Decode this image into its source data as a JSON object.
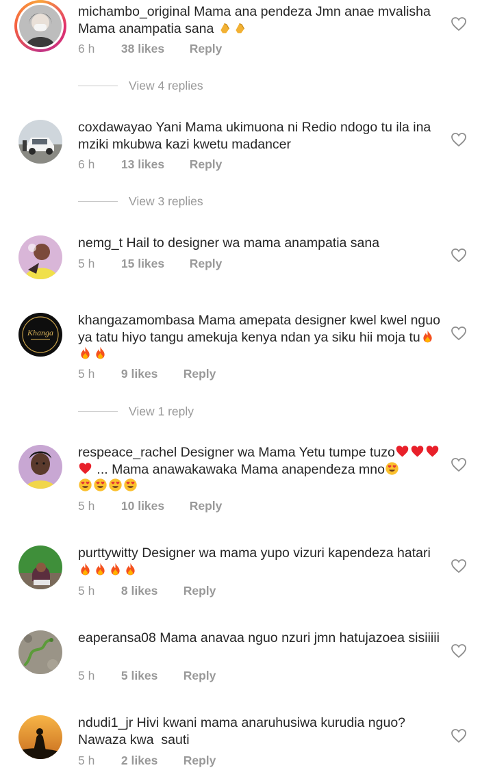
{
  "comments": [
    {
      "username": "michambo_original",
      "text": "Mama ana pendeza Jmn anae mvalisha Mama anampatia sana",
      "emojis": [
        "clap",
        "clap"
      ],
      "time": "6 h",
      "likes": "38 likes",
      "reply": "Reply",
      "view_replies": "View 4 replies",
      "avatar_icon": "woman-mask-avatar"
    },
    {
      "username": "coxdawayao",
      "text": "Yani Mama ukimuona ni Redio ndogo tu ila ina mziki mkubwa kazi kwetu madancer",
      "emojis": [],
      "time": "6 h",
      "likes": "13 likes",
      "reply": "Reply",
      "view_replies": "View 3 replies",
      "avatar_icon": "car-avatar"
    },
    {
      "username": "nemg_t",
      "text": "Hail to designer wa mama anampatia sana",
      "emojis": [],
      "time": "5 h",
      "likes": "15 likes",
      "reply": "Reply",
      "view_replies": "",
      "avatar_icon": "woman-yellow-avatar"
    },
    {
      "username": "khangazamombasa",
      "text": "Mama amepata designer kwel kwel nguo ya tatu hiyo tangu amekuja kenya ndan ya siku hii moja tu",
      "emojis": [
        "fire",
        "fire",
        "fire"
      ],
      "time": "5 h",
      "likes": "9 likes",
      "reply": "Reply",
      "view_replies": "View 1 reply",
      "avatar_icon": "khanga-logo-avatar",
      "avatar_text": "Khanga"
    },
    {
      "username": "respeace_rachel",
      "text_parts": [
        {
          "t": "Designer wa Mama Yetu tumpe tuzo"
        },
        {
          "e": "heart"
        },
        {
          "e": "heart"
        },
        {
          "e": "heart"
        },
        {
          "e": "heart"
        },
        {
          "t": " ... Mama anawakawaka Mama anapendeza mno"
        },
        {
          "e": "heart-eyes"
        },
        {
          "e": "heart-eyes"
        },
        {
          "e": "heart-eyes"
        },
        {
          "e": "heart-eyes"
        },
        {
          "e": "heart-eyes"
        }
      ],
      "time": "5 h",
      "likes": "10 likes",
      "reply": "Reply",
      "view_replies": "",
      "avatar_icon": "woman-portrait-avatar"
    },
    {
      "username": "purttywitty",
      "text": "Designer wa mama yupo vizuri kapendeza hatari",
      "emojis": [
        "fire",
        "fire",
        "fire",
        "fire"
      ],
      "time": "5 h",
      "likes": "8 likes",
      "reply": "Reply",
      "view_replies": "",
      "avatar_icon": "woman-hijab-avatar"
    },
    {
      "username": "eaperansa08",
      "text": "Mama anavaa nguo nzuri jmn hatujazoea sisiiiii",
      "emojis": [],
      "time": "5 h",
      "likes": "5 likes",
      "reply": "Reply",
      "view_replies": "",
      "avatar_icon": "snake-avatar"
    },
    {
      "username": "ndudi1_jr",
      "text": "Hivi kwani mama anaruhusiwa kurudia nguo? Nawaza kwa  sauti",
      "emojis": [],
      "time": "5 h",
      "likes": "2 likes",
      "reply": "Reply",
      "view_replies": "",
      "avatar_icon": "silhouette-sunset-avatar"
    }
  ]
}
